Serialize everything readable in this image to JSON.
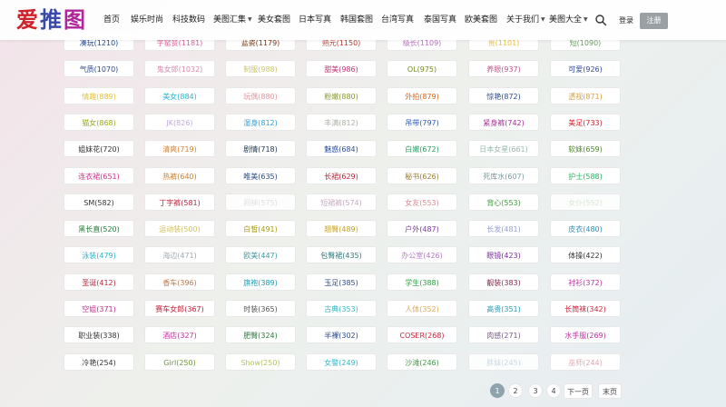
{
  "header": {
    "logo_chars": [
      "爱",
      "推",
      "图"
    ],
    "nav": [
      {
        "label": "首页",
        "caret": false
      },
      {
        "label": "娱乐时尚",
        "caret": false
      },
      {
        "label": "科技数码",
        "caret": false
      },
      {
        "label": "美图汇集",
        "caret": true
      },
      {
        "label": "美女套图",
        "caret": false
      },
      {
        "label": "日本写真",
        "caret": false
      },
      {
        "label": "韩国套图",
        "caret": false
      },
      {
        "label": "台湾写真",
        "caret": false
      },
      {
        "label": "泰国写真",
        "caret": false
      },
      {
        "label": "欧美套图",
        "caret": false
      },
      {
        "label": "关于我们",
        "caret": true
      },
      {
        "label": "美图大全",
        "caret": true
      }
    ],
    "login_label": "登录",
    "register_label": "注册"
  },
  "tags": [
    {
      "label": "凑玩(1210)",
      "color": "#1a4a9e"
    },
    {
      "label": "字窑赞(1181)",
      "color": "#e05d9a"
    },
    {
      "label": "蓝瓷(1179)",
      "color": "#7a3a1a"
    },
    {
      "label": "熟元(1150)",
      "color": "#c0392b"
    },
    {
      "label": "级长(1109)",
      "color": "#c06fc8"
    },
    {
      "label": "贵(1101)",
      "color": "#e8c14a"
    },
    {
      "label": "短(1090)",
      "color": "#6aa061"
    },
    {
      "label": "气质(1070)",
      "color": "#2c4a8a"
    },
    {
      "label": "鬼女郎(1032)",
      "color": "#d88aa8"
    },
    {
      "label": "制服(988)",
      "color": "#c8c46a"
    },
    {
      "label": "甜美(986)",
      "color": "#c23276"
    },
    {
      "label": "OL(975)",
      "color": "#6c8a1f"
    },
    {
      "label": "养眼(937)",
      "color": "#c0558a"
    },
    {
      "label": "可爱(926)",
      "color": "#2d4a9e"
    },
    {
      "label": "情趣(889)",
      "color": "#e6c23a"
    },
    {
      "label": "美女(884)",
      "color": "#2ab5d0"
    },
    {
      "label": "玩偶(880)",
      "color": "#e8939a"
    },
    {
      "label": "粉嫩(880)",
      "color": "#8a9a2a"
    },
    {
      "label": "外拍(879)",
      "color": "#e0641a"
    },
    {
      "label": "惊艳(872)",
      "color": "#2c4a8a"
    },
    {
      "label": "透视(871)",
      "color": "#d8a040"
    },
    {
      "label": "猫女(868)",
      "color": "#9aa81a"
    },
    {
      "label": "JK(826)",
      "color": "#c0a8d8"
    },
    {
      "label": "湿身(812)",
      "color": "#2d9ad0"
    },
    {
      "label": "丰满(812)",
      "color": "#a8b0a0"
    },
    {
      "label": "吊带(797)",
      "color": "#2a5ab5"
    },
    {
      "label": "紧身裤(742)",
      "color": "#a82a9a"
    },
    {
      "label": "美足(733)",
      "color": "#d0212a"
    },
    {
      "label": "姐妹花(720)",
      "color": "#333333"
    },
    {
      "label": "清爽(719)",
      "color": "#d98030"
    },
    {
      "label": "剧情(718)",
      "color": "#1f3a60"
    },
    {
      "label": "魅惑(684)",
      "color": "#2a4fa0"
    },
    {
      "label": "白嫩(672)",
      "color": "#27a060"
    },
    {
      "label": "日本女星(661)",
      "color": "#9ab8b0"
    },
    {
      "label": "软妹(659)",
      "color": "#4a8a2a"
    },
    {
      "label": "连衣裙(651)",
      "color": "#d0308a"
    },
    {
      "label": "热裤(640)",
      "color": "#c88030"
    },
    {
      "label": "唯美(635)",
      "color": "#2a4a80"
    },
    {
      "label": "长裙(629)",
      "color": "#c0243a"
    },
    {
      "label": "秘书(626)",
      "color": "#9a7a30"
    },
    {
      "label": "死库水(607)",
      "color": "#7a9aa0"
    },
    {
      "label": "护士(588)",
      "color": "#2ab560"
    },
    {
      "label": "SM(582)",
      "color": "#333333"
    },
    {
      "label": "丁字裤(581)",
      "color": "#c0243a"
    },
    {
      "label": "网袜(575)",
      "color": "#dde0e4"
    },
    {
      "label": "短裙裤(574)",
      "color": "#c8a8c0"
    },
    {
      "label": "女友(553)",
      "color": "#e08890"
    },
    {
      "label": "背心(553)",
      "color": "#3aa03a"
    },
    {
      "label": "女仆(552)",
      "color": "#d8e8d0"
    },
    {
      "label": "黑长直(520)",
      "color": "#2a7a3a"
    },
    {
      "label": "运动装(500)",
      "color": "#d0c060"
    },
    {
      "label": "白皙(491)",
      "color": "#a89a1a"
    },
    {
      "label": "翘臀(489)",
      "color": "#c8a020"
    },
    {
      "label": "户外(487)",
      "color": "#7a3a9a"
    },
    {
      "label": "长发(481)",
      "color": "#9aa0d0"
    },
    {
      "label": "皮衣(480)",
      "color": "#3a8ab5"
    },
    {
      "label": "泳装(479)",
      "color": "#2ab5c8"
    },
    {
      "label": "海边(471)",
      "color": "#a0a8b0"
    },
    {
      "label": "欧美(447)",
      "color": "#3a9aa0"
    },
    {
      "label": "包臀裙(435)",
      "color": "#2a7a7a"
    },
    {
      "label": "办公室(426)",
      "color": "#b878c8"
    },
    {
      "label": "眼镜(423)",
      "color": "#7a2a9a"
    },
    {
      "label": "体操(422)",
      "color": "#333333"
    },
    {
      "label": "圣诞(412)",
      "color": "#c0243a"
    },
    {
      "label": "香车(396)",
      "color": "#c07a50"
    },
    {
      "label": "旗袍(389)",
      "color": "#1a9ab5"
    },
    {
      "label": "玉足(385)",
      "color": "#2a4a8a"
    },
    {
      "label": "学生(388)",
      "color": "#2aa040"
    },
    {
      "label": "靓装(383)",
      "color": "#8a2a4a"
    },
    {
      "label": "衬衫(372)",
      "color": "#c030a0"
    },
    {
      "label": "空姐(371)",
      "color": "#c0308a"
    },
    {
      "label": "赛车女郎(367)",
      "color": "#c0243a"
    },
    {
      "label": "时装(365)",
      "color": "#555555"
    },
    {
      "label": "古典(353)",
      "color": "#3ab5c8"
    },
    {
      "label": "人体(352)",
      "color": "#e0a850"
    },
    {
      "label": "高贵(351)",
      "color": "#2a9ab5"
    },
    {
      "label": "长筒袜(342)",
      "color": "#d0243a"
    },
    {
      "label": "职业装(338)",
      "color": "#333333"
    },
    {
      "label": "酒店(327)",
      "color": "#c030a0"
    },
    {
      "label": "肥臀(324)",
      "color": "#2a7a3a"
    },
    {
      "label": "半裸(302)",
      "color": "#2a4a8a"
    },
    {
      "label": "COSER(268)",
      "color": "#d0243a"
    },
    {
      "label": "肉感(271)",
      "color": "#7a5a8a"
    },
    {
      "label": "水手服(269)",
      "color": "#c030a0"
    },
    {
      "label": "冷艳(254)",
      "color": "#333333"
    },
    {
      "label": "Girl(250)",
      "color": "#6a9a2a"
    },
    {
      "label": "Show(250)",
      "color": "#b8c060"
    },
    {
      "label": "女警(249)",
      "color": "#3ab5c8"
    },
    {
      "label": "沙滩(246)",
      "color": "#3aa040"
    },
    {
      "label": "胖妹(245)",
      "color": "#c0d8e8"
    },
    {
      "label": "巫师(244)",
      "color": "#e0a8b0"
    }
  ],
  "pagination": {
    "pages": [
      "1",
      "2",
      "3",
      "4"
    ],
    "active_page": "1",
    "next_label": "下一页",
    "last_label": "末页"
  }
}
